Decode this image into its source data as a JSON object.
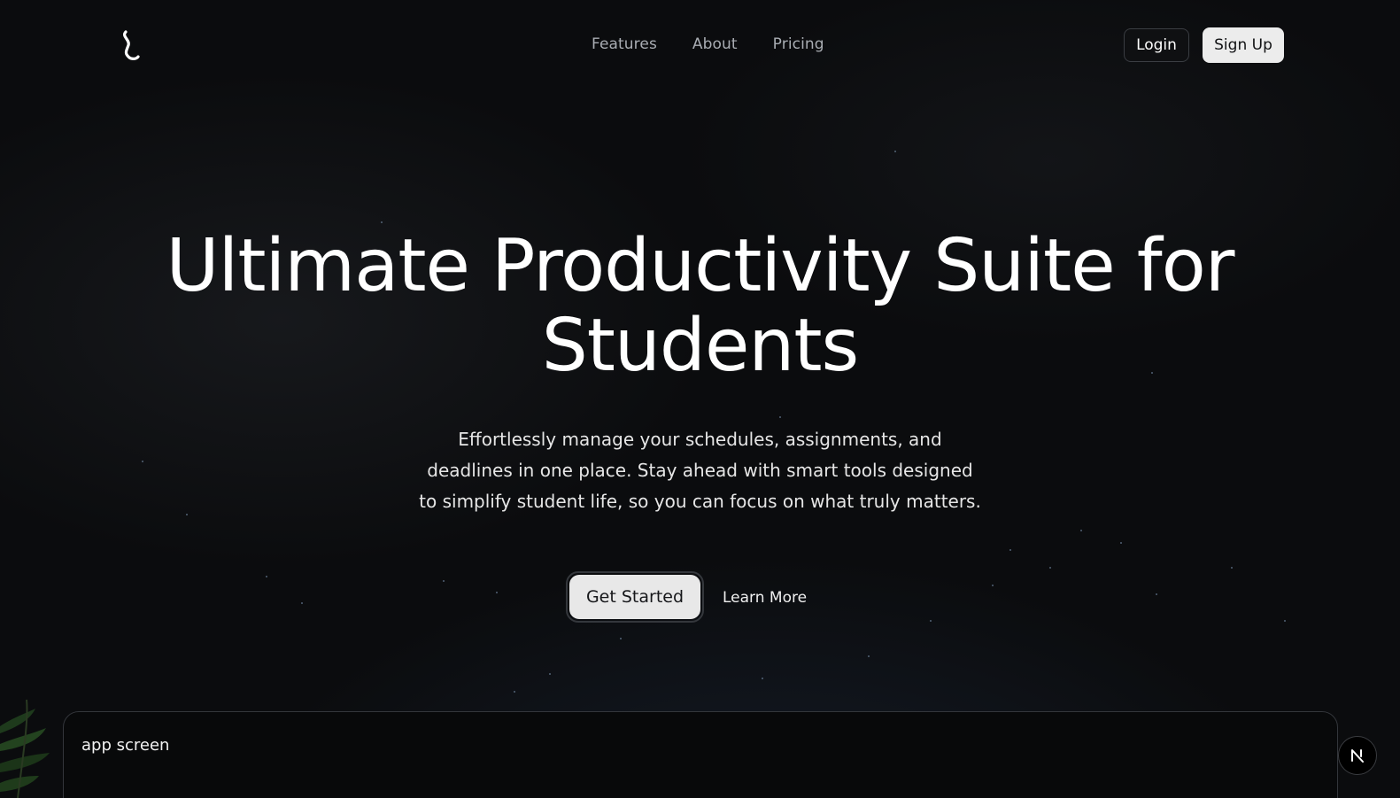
{
  "header": {
    "logo_icon": "squiggle-logo-icon",
    "nav": [
      {
        "label": "Features"
      },
      {
        "label": "About"
      },
      {
        "label": "Pricing"
      }
    ],
    "login_label": "Login",
    "signup_label": "Sign Up"
  },
  "hero": {
    "title_line1": "Ultimate Productivity Suite for",
    "title_line2": "Students",
    "subtitle": "Effortlessly manage your schedules, assignments, and deadlines in one place. Stay ahead with smart tools designed to simplify student life, so you can focus on what truly matters.",
    "primary_cta": "Get Started",
    "secondary_cta": "Learn More"
  },
  "app_preview": {
    "label": "app screen"
  },
  "dev_badge": {
    "icon": "next-n-icon"
  },
  "colors": {
    "background": "#0b0c0e",
    "text": "#ffffff",
    "nav_text": "#a9adb3",
    "button_light": "#ececec"
  }
}
